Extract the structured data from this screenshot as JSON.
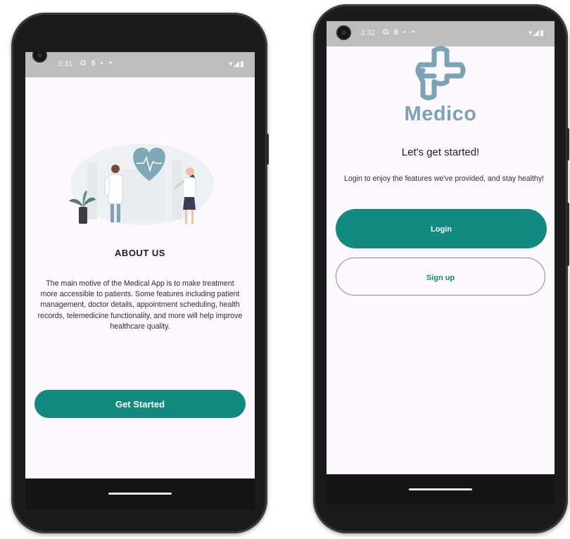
{
  "colors": {
    "accent": "#138a80",
    "brand": "#7aa3b5",
    "screen_bg": "#fdf8fd"
  },
  "phone1": {
    "status": {
      "time": "3:31",
      "icons": "G 6 ▪ ◓",
      "right": "▾◢▮"
    },
    "about": {
      "title": "ABOUT US",
      "text": "The main motive of the Medical App is to make treatment more accessible to patients. Some features including patient management, doctor details, appointment scheduling, health records, telemedicine functionality, and more will help improve healthcare quality."
    },
    "button": {
      "label": "Get Started"
    },
    "illustration_icon": "doctors-heart-illustration"
  },
  "phone2": {
    "status": {
      "time": "3:32",
      "icons": "G 6 ▪ ◓",
      "right": "▾◢▮"
    },
    "logo_icon": "medical-cross-logo",
    "brand": "Medico",
    "heading": "Let's get started!",
    "subtext": "Login to enjoy the features we've provided, and stay healthy!",
    "login_label": "Login",
    "signup_label": "Sign up"
  }
}
